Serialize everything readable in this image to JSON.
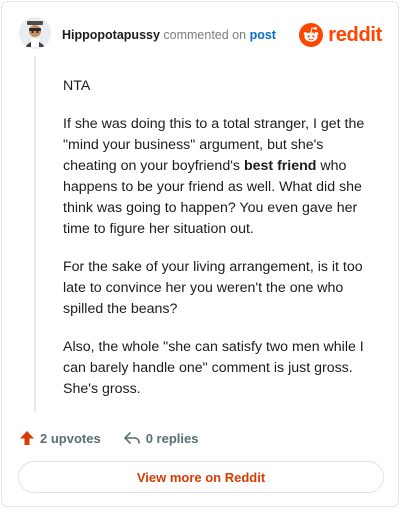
{
  "comment": {
    "username": "Hippopotapussy",
    "commented_on": "commented on",
    "post_link": "post",
    "paragraphs": [
      {
        "text": "NTA"
      },
      {
        "before": "If she was doing this to a total stranger, I get the \"mind your business\" argument, but she's cheating on your boyfriend's ",
        "bold": "best friend",
        "after": " who happens to be your friend as well. What did she think was going to happen? You even gave her time to figure her situation out."
      },
      {
        "text": "For the sake of your living arrangement, is it too late to convince her you weren't the one who spilled the beans?"
      },
      {
        "text": "Also, the whole \"she can satisfy two men while I can barely handle one\" comment is just gross. She's gross."
      }
    ]
  },
  "brand": {
    "name": "reddit",
    "icon": "reddit-snoo-icon",
    "color": "#ff4500"
  },
  "actions": {
    "upvotes_label": "2 upvotes",
    "replies_label": "0 replies",
    "upvote_icon": "upvote-arrow-icon",
    "reply_icon": "reply-arrow-icon",
    "upvote_color": "#d93a00"
  },
  "footer": {
    "view_more_label": "View more on Reddit"
  }
}
